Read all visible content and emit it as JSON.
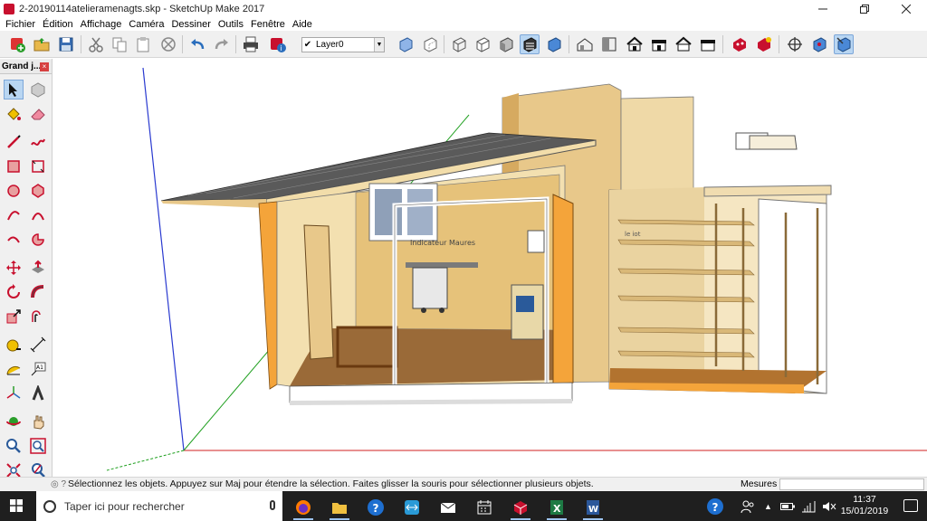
{
  "window": {
    "title": "2-20190114atelieramenagts.skp - SketchUp Make 2017",
    "controls": [
      "minimize",
      "restore",
      "close"
    ]
  },
  "menu": [
    "Fichier",
    "Édition",
    "Affichage",
    "Caméra",
    "Dessiner",
    "Outils",
    "Fenêtre",
    "Aide"
  ],
  "toolbar": {
    "layer_current": "Layer0",
    "icons": [
      "getting-started-icon",
      "open-icon",
      "save-icon",
      "cut-icon",
      "copy-icon",
      "paste-icon",
      "erase-icon",
      "undo-icon",
      "redo-icon",
      "print-icon",
      "model-info-icon",
      "xray-icon",
      "back-edges-icon",
      "wireframe-icon",
      "hidden-line-icon",
      "shaded-icon",
      "shaded-textures-icon",
      "monochrome-icon",
      "iso-view-icon",
      "top-view-icon",
      "front-view-icon",
      "right-view-icon",
      "back-view-icon",
      "left-view-icon",
      "warehouse-icon",
      "extension-warehouse-icon",
      "position-camera-icon",
      "walk-icon",
      "look-around-icon"
    ]
  },
  "tool_palette": {
    "title": "Grand j...",
    "tools": [
      "select-icon",
      "component-icon",
      "paint-bucket-icon",
      "eraser-icon",
      "line-icon",
      "freehand-icon",
      "rectangle-icon",
      "rotated-rectangle-icon",
      "circle-icon",
      "polygon-icon",
      "arc-icon",
      "arc-2point-icon",
      "arc-3point-icon",
      "pie-icon",
      "move-icon",
      "push-pull-icon",
      "rotate-icon",
      "follow-me-icon",
      "scale-icon",
      "offset-icon",
      "tape-measure-icon",
      "dimension-icon",
      "protractor-icon",
      "text-icon",
      "axes-icon",
      "3d-text-icon",
      "orbit-icon",
      "pan-icon",
      "zoom-icon",
      "zoom-window-icon",
      "zoom-extents-icon",
      "previous-view-icon"
    ]
  },
  "viewport": {
    "labels": [
      "Indicateur Maures",
      "le iot"
    ]
  },
  "status": {
    "text": "Sélectionnez les objets. Appuyez sur Maj pour étendre la sélection. Faites glisser la souris pour sélectionner plusieurs objets.",
    "measure_label": "Mesures",
    "measure_value": ""
  },
  "taskbar": {
    "search_placeholder": "Taper ici pour rechercher",
    "apps": [
      "firefox-icon",
      "file-explorer-icon",
      "help-icon",
      "teamviewer-icon",
      "mail-icon",
      "calendar-icon",
      "sketchup-icon",
      "excel-icon",
      "word-icon"
    ],
    "time": "11:37",
    "date": "15/01/2019"
  },
  "colors": {
    "toolbar_bg": "#f0f0f0",
    "taskbar_bg": "#1f1f1f",
    "wood": "#e6c27a",
    "orange": "#f4a43a",
    "roof": "#5d5d5d",
    "floor": "#9a6a38"
  }
}
